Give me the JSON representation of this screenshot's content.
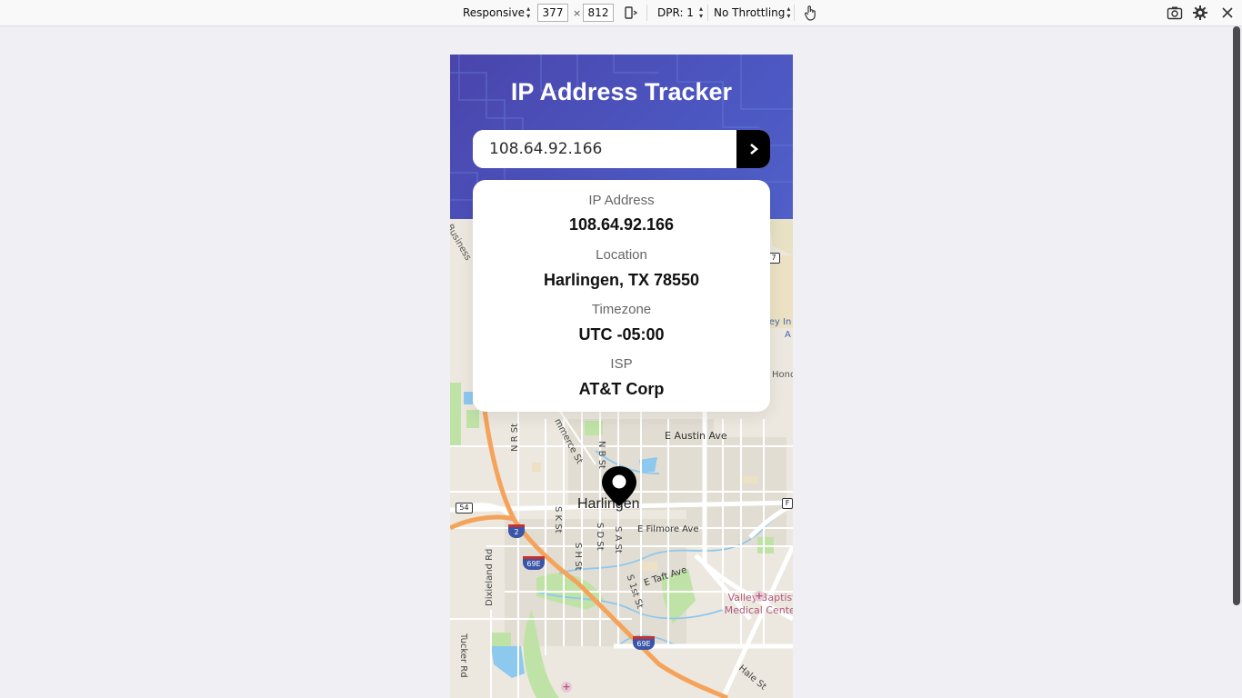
{
  "devtools": {
    "device_mode": "Responsive",
    "width": "377",
    "times": "×",
    "height": "812",
    "dpr": "DPR: 1",
    "throttling": "No Throttling",
    "icons": [
      "rotate-icon",
      "touch-icon",
      "screenshot-icon",
      "settings-icon",
      "close-icon"
    ]
  },
  "app": {
    "title": "IP Address Tracker",
    "search": {
      "value": "108.64.92.166"
    },
    "info": {
      "ip_label": "IP Address",
      "ip_value": "108.64.92.166",
      "location_label": "Location",
      "location_value": "Harlingen, TX 78550",
      "timezone_label": "Timezone",
      "timezone_value": "UTC -05:00",
      "isp_label": "ISP",
      "isp_value": "AT&T Corp"
    },
    "colors": {
      "header": "#4c50b8",
      "button": "#000000",
      "card": "#ffffff"
    }
  },
  "map": {
    "city": "Harlingen",
    "labels": {
      "business": "Business",
      "commerce": "mmerce St",
      "n_r_st": "N R St",
      "n_b_st": "N B St",
      "e_austin": "E Austin Ave",
      "s_k_st": "S K St",
      "s_d_st": "S D St",
      "s_a_st": "S A St",
      "s_h_st": "S H St",
      "e_filmore": "E Filmore Ave",
      "e_taft": "E Taft Ave",
      "s_1st": "S 1st St",
      "dixieland": "Dixieland Rd",
      "tucker": "Tucker Rd",
      "hale": "Hale St",
      "valley_top": "ley In",
      "valley_a": "A",
      "hond": "Hond",
      "hospital1": "Valley Baptist",
      "hospital2": "Medical Center",
      "shield_54": "54",
      "shield_i2": "2",
      "shield_69e_a": "69E",
      "shield_69e_b": "69E",
      "shield_77": "7",
      "shield_f": "F"
    }
  }
}
